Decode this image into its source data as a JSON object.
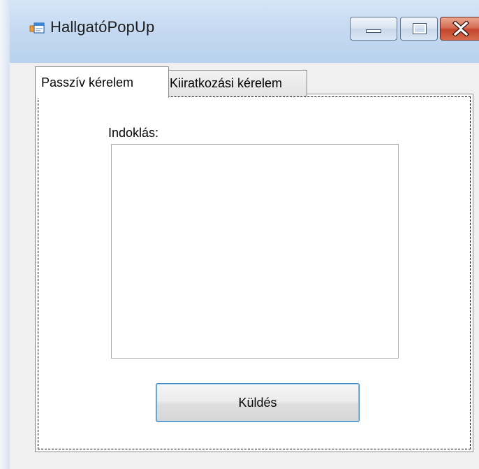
{
  "window": {
    "title": "HallgatóPopUp"
  },
  "tabs": [
    {
      "label": "Passzív kérelem",
      "selected": true
    },
    {
      "label": "Kiiratkozási kérelem",
      "selected": false
    }
  ],
  "form": {
    "reason_label": "Indoklás:",
    "reason_value": "",
    "send_label": "Küldés"
  },
  "colors": {
    "close_button": "#c5452d",
    "focus_border": "#3c7fb1",
    "client_background": "#f0f0f0"
  }
}
